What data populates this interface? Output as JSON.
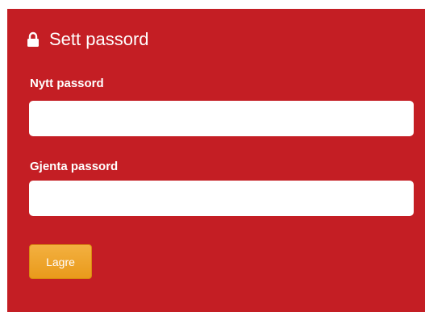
{
  "form": {
    "title": "Sett passord",
    "title_icon": "lock-icon",
    "new_password_label": "Nytt passord",
    "new_password_value": "",
    "repeat_password_label": "Gjenta passord",
    "repeat_password_value": "",
    "save_label": "Lagre"
  },
  "colors": {
    "panel_background": "#c41e24",
    "button_background": "#eda22a",
    "text": "#ffffff"
  }
}
